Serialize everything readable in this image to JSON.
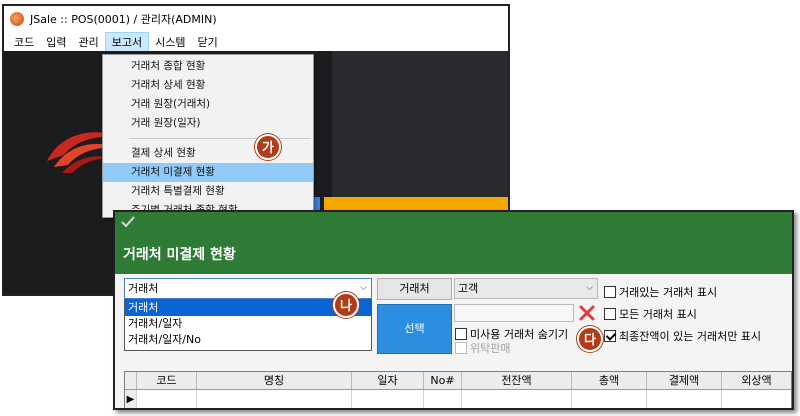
{
  "main_window": {
    "title": "JSale  ::  POS(0001) / 관리자(ADMIN)",
    "menu": [
      "코드",
      "입력",
      "관리",
      "보고서",
      "시스템",
      "닫기"
    ],
    "active_menu_index": 3
  },
  "report_menu": {
    "group1": [
      "거래처 종합 현황",
      "거래처 상세 현황",
      "거래 원장(거래처)",
      "거래 원장(일자)"
    ],
    "group2": [
      "결제 상세 현황",
      "거래처 미결제 현황",
      "거래처 특별결제 현황",
      "주기별 거래처 종합 현황"
    ],
    "highlighted": "거래처 미결제 현황"
  },
  "markers": {
    "a": "가",
    "b": "나",
    "c": "다"
  },
  "report_window": {
    "title": "거래처 미결제 현황",
    "group_combo": {
      "value": "거래처",
      "options": [
        "거래처",
        "거래처/일자",
        "거래처/일자/No"
      ]
    },
    "partner_button": "거래처",
    "customer_combo": "고객",
    "select_button": "선택",
    "checkboxes": {
      "show_traded": "거래있는 거래처 표시",
      "show_all": "모든 거래처 표시",
      "final_balance_only": "최종잔액이 있는 거래처만 표시",
      "hide_unused": "미사용 거래처 숨기기",
      "consignment": "위탁판매"
    },
    "columns": [
      "코드",
      "명칭",
      "일자",
      "No#",
      "전잔액",
      "총액",
      "결제액",
      "외상액"
    ]
  },
  "colors": {
    "header_green": "#2f7b36",
    "select_blue": "#2c8ee0",
    "marker": "#b23c18",
    "highlight": "#91c9f7"
  }
}
